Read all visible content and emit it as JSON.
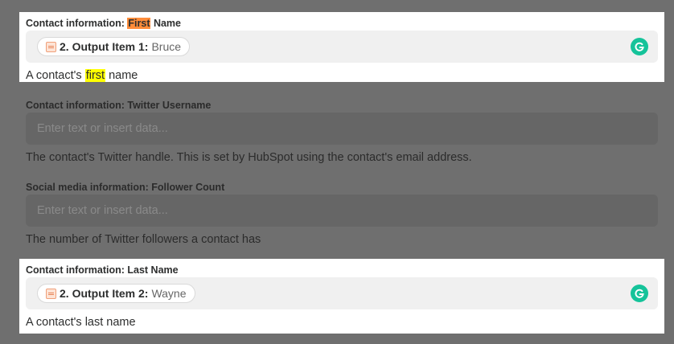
{
  "fields": [
    {
      "label_prefix": "Contact information: ",
      "label_highlight": "First",
      "label_suffix": " Name",
      "pill_name": "2. Output Item 1:",
      "pill_value": "Bruce",
      "help_prefix": "A contact's ",
      "help_highlight": "first",
      "help_suffix": " name"
    },
    {
      "label": "Contact information: Twitter Username",
      "placeholder": "Enter text or insert data...",
      "help": "The contact's Twitter handle. This is set by HubSpot using the contact's email address."
    },
    {
      "label": "Social media information: Follower Count",
      "placeholder": "Enter text or insert data...",
      "help": "The number of Twitter followers a contact has"
    },
    {
      "label": "Contact information: Last Name",
      "pill_name": "2. Output Item 2:",
      "pill_value": "Wayne",
      "help": "A contact's last name"
    }
  ],
  "colors": {
    "highlight_orange": "#ff8c3a",
    "highlight_yellow": "#ffff00",
    "grammarly_green": "#15c39a",
    "overlay": "#6f6f6f"
  },
  "icons": {
    "pill_icon": "formatter-app-icon",
    "grammarly": "grammarly-icon"
  }
}
